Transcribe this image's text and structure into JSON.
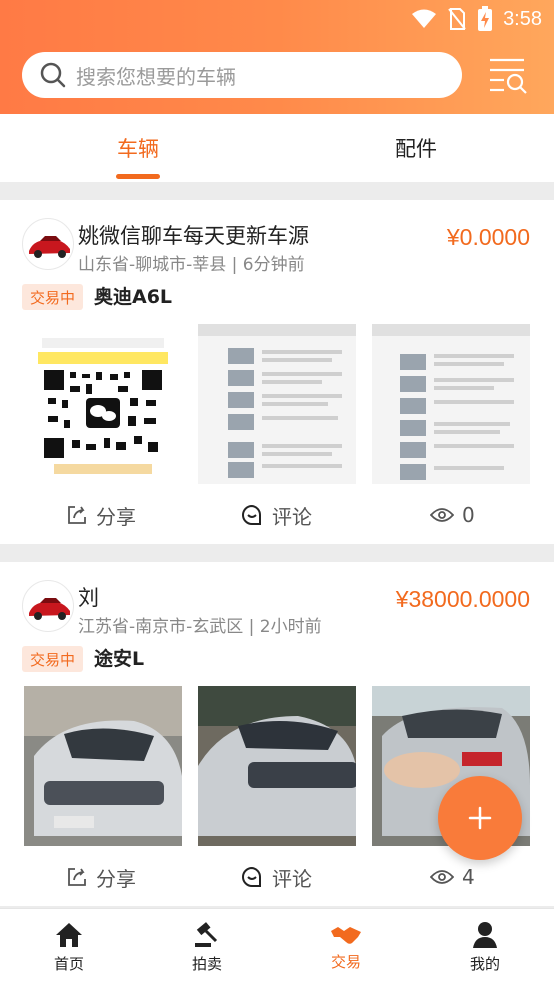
{
  "status_bar": {
    "time": "3:58"
  },
  "search": {
    "placeholder": "搜索您想要的车辆"
  },
  "tabs": [
    {
      "label": "车辆",
      "active": true
    },
    {
      "label": "配件",
      "active": false
    }
  ],
  "listings": [
    {
      "seller": "姚微信聊车每天更新车源",
      "location": "山东省-聊城市-莘县 | 6分钟前",
      "price": "¥0.0000",
      "status": "交易中",
      "model": "奥迪A6L",
      "share_label": "分享",
      "comment_label": "评论",
      "views": "0"
    },
    {
      "seller": "刘",
      "location": "江苏省-南京市-玄武区 | 2小时前",
      "price": "¥38000.0000",
      "status": "交易中",
      "model": "途安L",
      "share_label": "分享",
      "comment_label": "评论",
      "views": "4"
    }
  ],
  "bottom_nav": [
    {
      "label": "首页",
      "icon": "home-icon"
    },
    {
      "label": "拍卖",
      "icon": "auction-icon"
    },
    {
      "label": "交易",
      "icon": "handshake-icon",
      "active": true
    },
    {
      "label": "我的",
      "icon": "user-icon"
    }
  ],
  "colors": {
    "accent": "#f26a1e",
    "header_gradient_start": "#ff7a45",
    "header_gradient_end": "#ffa75c"
  }
}
